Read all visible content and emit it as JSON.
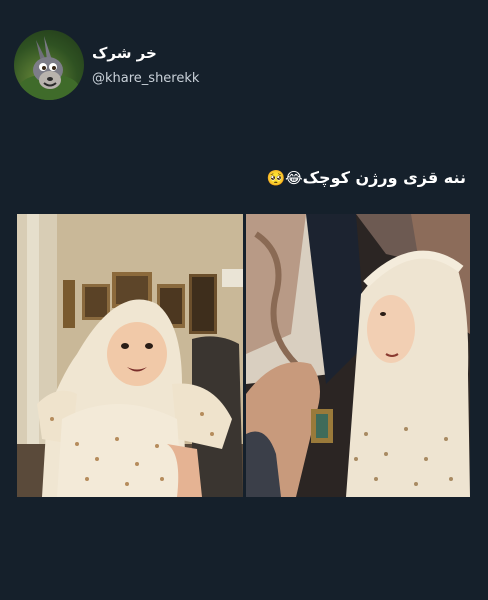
{
  "header": {
    "display_name": "خر شرک",
    "handle": "@khare_sherekk"
  },
  "tweet": {
    "text": "ننه قزی ورژن کوچک",
    "emojis": "😂🥺"
  },
  "icons": {
    "avatar": "donkey-avatar-icon"
  },
  "colors": {
    "background": "#15202b",
    "text_primary": "#ffffff",
    "text_secondary": "#c9d1d9"
  }
}
